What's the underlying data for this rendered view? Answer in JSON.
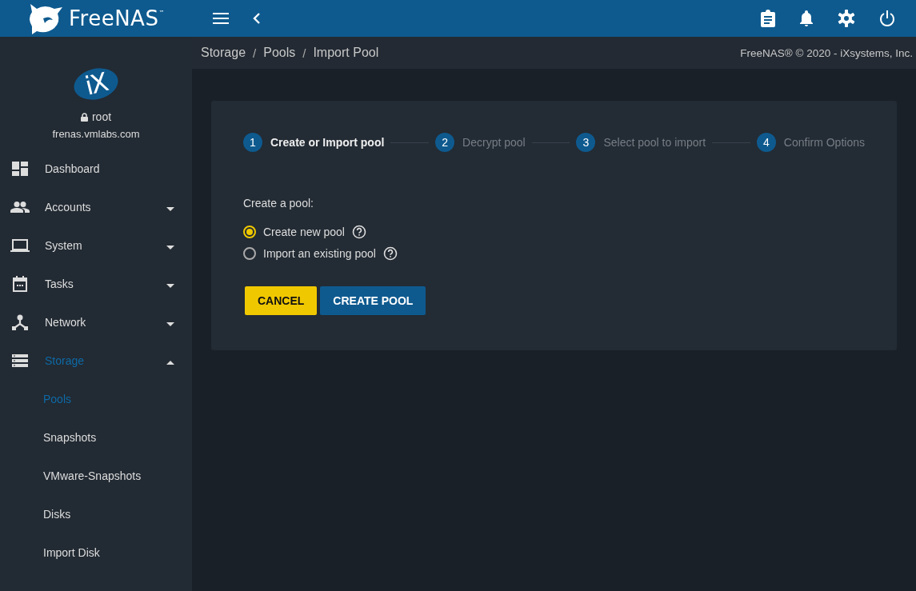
{
  "topbar": {
    "brand": "FreeNAS$^{™}$"
  },
  "user": {
    "logo": "iX",
    "name": "root",
    "host": "frenas.vmlabs.com"
  },
  "sidebar": {
    "items": [
      {
        "label": "Dashboard",
        "kind": "link",
        "selected": false
      },
      {
        "label": "Accounts",
        "kind": "group",
        "expanded": false,
        "selected": false
      },
      {
        "label": "System",
        "kind": "group",
        "expanded": false,
        "selected": false
      },
      {
        "label": "Tasks",
        "kind": "group",
        "expanded": false,
        "selected": false
      },
      {
        "label": "Network",
        "kind": "group",
        "expanded": false,
        "selected": false
      },
      {
        "label": "Storage",
        "kind": "group",
        "expanded": true,
        "selected": true,
        "children": [
          {
            "label": "Pools",
            "selected": true
          },
          {
            "label": "Snapshots",
            "selected": false
          },
          {
            "label": "VMware-Snapshots",
            "selected": false
          },
          {
            "label": "Disks",
            "selected": false
          },
          {
            "label": "Import Disk",
            "selected": false
          }
        ]
      }
    ]
  },
  "breadcrumb": [
    {
      "text": "Storage",
      "kind": "link"
    },
    {
      "text": "/",
      "kind": "separator"
    },
    {
      "text": "Pools",
      "kind": "link"
    },
    {
      "text": "/",
      "kind": "separator"
    },
    {
      "text": "Import Pool",
      "kind": "link"
    }
  ],
  "copyright": "FreeNAS® © 2020 - iXsystems, Inc.",
  "stepper": [
    {
      "number": "1",
      "label": "Create or Import pool",
      "selected": true
    },
    {
      "number": "2",
      "label": "Decrypt pool",
      "selected": false
    },
    {
      "number": "3",
      "label": "Select pool to import",
      "selected": false
    },
    {
      "number": "4",
      "label": "Confirm Options",
      "selected": false
    }
  ],
  "form": {
    "label": "Create a pool:",
    "options": [
      {
        "label": "Create new pool",
        "checked": true
      },
      {
        "label": "Import an existing pool",
        "checked": false
      }
    ],
    "buttons": [
      {
        "label": "CANCEL",
        "kind": "warn"
      },
      {
        "label": "CREATE POOL",
        "kind": "primary"
      }
    ]
  }
}
